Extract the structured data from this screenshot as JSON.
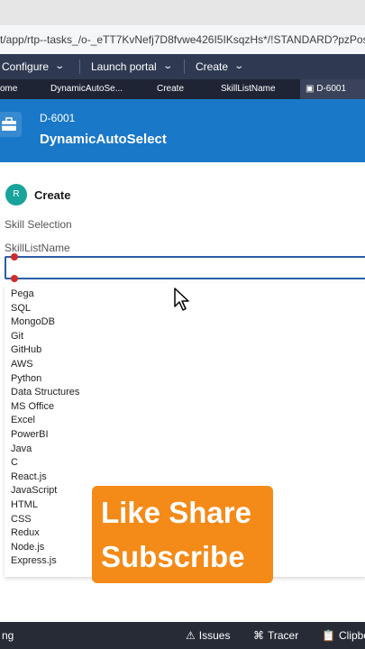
{
  "browser": {
    "url": "t/app/rtp--tasks_/o-_eTT7KvNefj7D8fvwe426I5IKsqzHs*/!STANDARD?pzPostDa"
  },
  "menubar": {
    "configure": "Configure",
    "launch_portal": "Launch portal",
    "create": "Create"
  },
  "tabs": [
    "ome",
    "DynamicAutoSe...",
    "Create",
    "SkillListName",
    "D-6001"
  ],
  "case": {
    "id": "D-6001",
    "title": "DynamicAutoSelect"
  },
  "form": {
    "avatar_initial": "R",
    "create_label": "Create",
    "section_label": "Skill Selection",
    "field_label": "SkillListName",
    "input_value": ""
  },
  "dropdown": {
    "options": [
      "Pega",
      "SQL",
      "MongoDB",
      "Git",
      "GitHub",
      "AWS",
      "Python",
      "Data Structures",
      "MS Office",
      "Excel",
      "PowerBI",
      "Java",
      "C",
      "React.js",
      "JavaScript",
      "HTML",
      "CSS",
      "Redux",
      "Node.js",
      "Express.js"
    ]
  },
  "promo": {
    "line1": "Like Share",
    "line2": "Subscribe"
  },
  "statusbar": {
    "left": "ng",
    "issues": "Issues",
    "tracer": "Tracer",
    "clipboard": "Clipbo"
  },
  "colors": {
    "menubar_bg": "#2f3a52",
    "header_bg": "#1a78c9",
    "avatar_bg": "#19a39a",
    "promo_bg": "#f48a18",
    "input_border": "#2a5ea6"
  },
  "icons": [
    "briefcase-icon",
    "pointer-cursor-icon",
    "warning-icon",
    "tracer-icon",
    "clipboard-icon",
    "chevron-down-icon"
  ]
}
